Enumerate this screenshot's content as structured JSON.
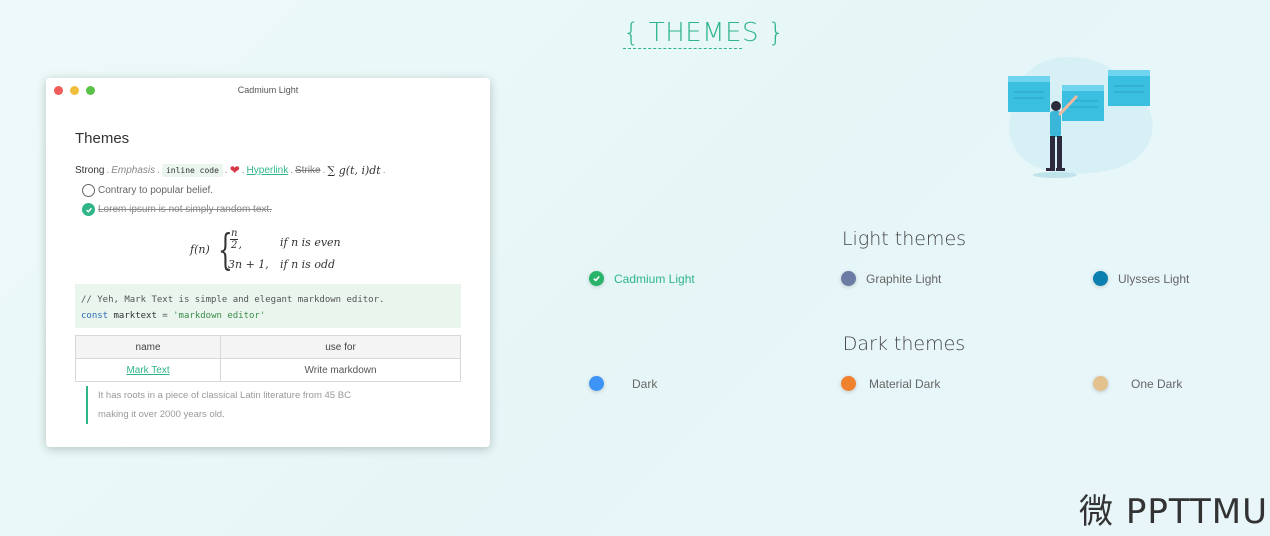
{
  "section": {
    "title": "{ THEMES }"
  },
  "window": {
    "title": "Cadmium Light",
    "doc": {
      "heading": "Themes",
      "inline": {
        "strong": "Strong",
        "emphasis": "Emphasis",
        "code": "inline code",
        "link": "Hyperlink",
        "strike": "Strike",
        "math": "∑ g(t, i)dt"
      },
      "tasks": [
        {
          "text": "Contrary to popular belief.",
          "done": false
        },
        {
          "text": "Lorem ipsum is not simply random text.",
          "done": true
        }
      ],
      "formula": {
        "fn": "f(n)",
        "case1_num": "n",
        "case1_den": "2",
        "case1_cond": "if n is even",
        "case2_expr": "3n + 1,",
        "case2_cond": "if n is odd"
      },
      "code": {
        "comment": "// Yeh, Mark Text is simple and elegant markdown editor.",
        "keyword": "const",
        "ident": "marktext",
        "op": "=",
        "string": "'markdown editor'"
      },
      "table": {
        "headers": [
          "name",
          "use for"
        ],
        "rows": [
          [
            "Mark Text",
            "Write markdown"
          ]
        ]
      },
      "quote": {
        "line1": "It has roots in a piece of classical Latin literature from 45 BC",
        "line2": "making it over 2000 years old."
      }
    }
  },
  "light_themes": {
    "title": "Light themes",
    "items": [
      {
        "label": "Cadmium Light",
        "color": "#27b36a",
        "active": true
      },
      {
        "label": "Graphite Light",
        "color": "#6b7ba3",
        "active": false
      },
      {
        "label": "Ulysses Light",
        "color": "#0b7fb0",
        "active": false
      }
    ]
  },
  "dark_themes": {
    "title": "Dark themes",
    "items": [
      {
        "label": "Dark",
        "color": "#3d94f6",
        "active": false
      },
      {
        "label": "Material Dark",
        "color": "#f0812f",
        "active": false
      },
      {
        "label": "One Dark",
        "color": "#e3c28d",
        "active": false
      }
    ]
  },
  "watermark": "微 PPTTMU"
}
